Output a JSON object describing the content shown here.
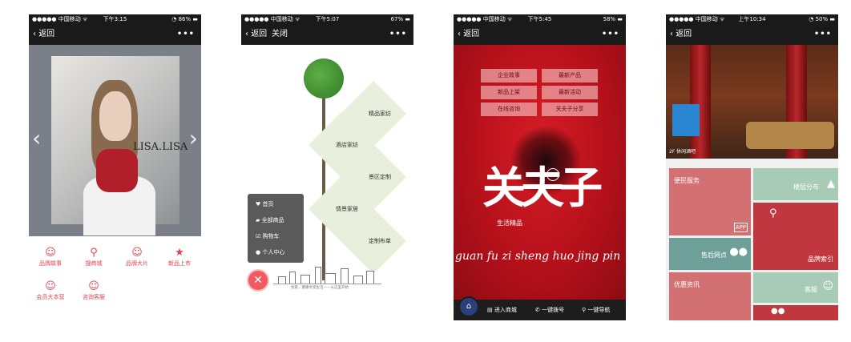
{
  "status_bars": [
    {
      "carrier": "●●●●● 中国移动 ᯤ",
      "time": "下午3:15",
      "battery": "◔ 86% ▬"
    },
    {
      "carrier": "●●●●● 中国移动 ᯤ",
      "time": "下午5:07",
      "battery": "67% ▬"
    },
    {
      "carrier": "●●●●● 中国移动 ᯤ",
      "time": "下午5:45",
      "battery": "58% ▬"
    },
    {
      "carrier": "●●●●● 中国移动 ᯤ",
      "time": "上午10:34",
      "battery": "◔ 50% ▬"
    }
  ],
  "nav": {
    "back": "返回",
    "close": "关闭",
    "more": "•••"
  },
  "phone1": {
    "brand": "LISA.LISA",
    "items": [
      "品牌故事",
      "搜商城",
      "品牌大片",
      "新品上市",
      "会员大本营",
      "咨询客服"
    ]
  },
  "phone2": {
    "diamonds": [
      "精品家纺",
      "酒店家纺",
      "景区定制",
      "情景家居",
      "定制布单"
    ],
    "menu": [
      "首页",
      "全部商品",
      "购物车",
      "个人中心"
    ],
    "slogan": "悦家，健康享受生活——从这里开始"
  },
  "phone3": {
    "menu": [
      "企业故事",
      "最新产品",
      "新品上架",
      "最新活动",
      "在线咨询",
      "关夫子分享"
    ],
    "calligraphy": "关夫子",
    "subtitle": "生活精品",
    "pinyin": "guan fu zi sheng huo jing pin",
    "bottom": [
      "进入商城",
      "一键拨号",
      "一键导航"
    ]
  },
  "phone4": {
    "caption": "2F 休闲酒吧",
    "tiles": [
      "便民服务",
      "楼层分布",
      "售后网点",
      "品牌索引",
      "优惠资讯",
      "客服"
    ]
  }
}
